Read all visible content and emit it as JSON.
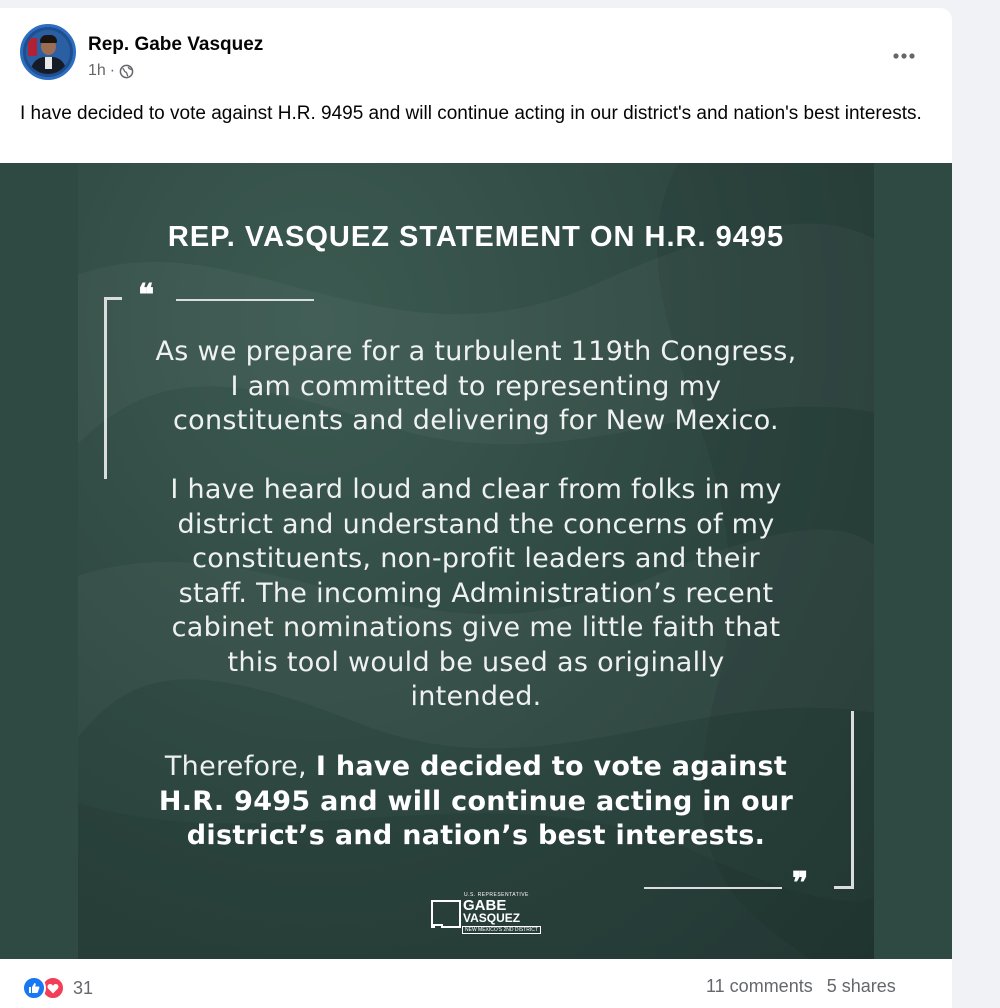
{
  "post": {
    "author": "Rep. Gabe Vasquez",
    "time": "1h",
    "separator": "·",
    "text": "I have decided to vote against H.R. 9495 and will continue acting in our district's and nation's best interests."
  },
  "graphic": {
    "heading": "REP. VASQUEZ STATEMENT ON H.R. 9495",
    "open_quote": "❝",
    "close_quote": "❞",
    "para1": [
      "As we prepare for a turbulent 119th Congress,",
      "I am committed to representing my",
      "constituents and delivering for New Mexico."
    ],
    "para2": [
      "I have heard loud and clear from folks in my",
      "district and understand the concerns of my",
      "constituents, non-profit leaders and their",
      "staff. The incoming Administration’s recent",
      "cabinet nominations give me little faith that",
      "this tool would be used as originally",
      "intended."
    ],
    "para3_lead": "Therefore, ",
    "para3_bold": [
      "I have decided to vote against",
      "H.R. 9495 and will continue acting in our",
      "district’s and nation’s best interests."
    ],
    "logo": {
      "small": "U.S. REPRESENTATIVE",
      "name1": "GABE",
      "name2": "VASQUEZ",
      "district": "NEW MEXICO'S 2ND DISTRICT"
    }
  },
  "footer": {
    "reaction_count": "31",
    "comments": "11 comments",
    "shares": "5 shares"
  },
  "icons": {
    "more": "more-options-icon",
    "audience": "globe-icon",
    "like": "like-reaction-icon",
    "love": "love-reaction-icon"
  },
  "colors": {
    "graphic_bg": "#2f4a42",
    "like": "#1877f2",
    "love": "#f33e58",
    "meta": "#65676b"
  }
}
